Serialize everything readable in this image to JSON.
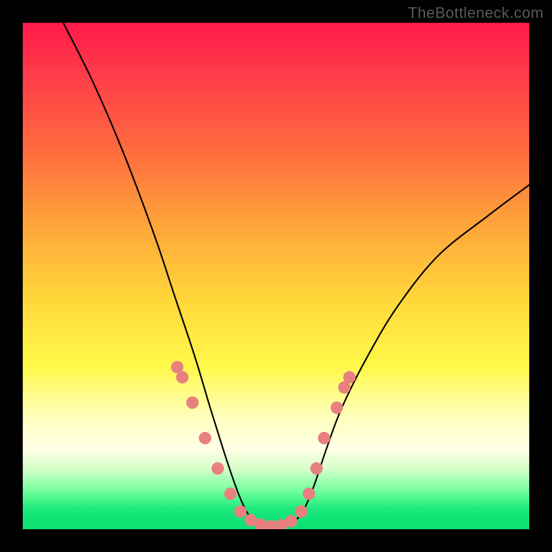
{
  "watermark": "TheBottleneck.com",
  "chart_data": {
    "type": "line",
    "title": "",
    "xlabel": "",
    "ylabel": "",
    "xlim": [
      0,
      100
    ],
    "ylim": [
      0,
      100
    ],
    "grid": false,
    "legend": null,
    "note": "Axes are unlabeled in the source image; values are normalized 0–100 estimated from pixel positions.",
    "series": [
      {
        "name": "curve",
        "color": "#000000",
        "x": [
          8,
          14,
          20,
          26,
          30,
          34,
          37,
          39.5,
          41.5,
          43,
          44.5,
          46,
          48,
          50,
          52,
          53.5,
          55,
          56.5,
          58,
          60,
          63,
          68,
          74,
          82,
          92,
          100
        ],
        "y": [
          100,
          88,
          74,
          58,
          46,
          34,
          24,
          16,
          10,
          6,
          3,
          1.5,
          0.7,
          0.5,
          0.7,
          1.5,
          3,
          6,
          10,
          16,
          24,
          34,
          44,
          54,
          62,
          68
        ]
      }
    ],
    "markers": {
      "name": "highlighted-points",
      "color": "#e98080",
      "radius_px": 9,
      "x": [
        30.5,
        31.5,
        33.5,
        36,
        38.5,
        41,
        43,
        45,
        47,
        49,
        51,
        53,
        55,
        56.5,
        58,
        59.5,
        62,
        63.5,
        64.5
      ],
      "y": [
        32,
        30,
        25,
        18,
        12,
        7,
        3.5,
        1.8,
        0.9,
        0.6,
        0.8,
        1.6,
        3.5,
        7,
        12,
        18,
        24,
        28,
        30
      ]
    },
    "gradient_stops": [
      {
        "pos": 0.0,
        "color": "#ff1a4a"
      },
      {
        "pos": 0.25,
        "color": "#ff6a3e"
      },
      {
        "pos": 0.55,
        "color": "#ffd83a"
      },
      {
        "pos": 0.78,
        "color": "#ffffbf"
      },
      {
        "pos": 0.92,
        "color": "#7dffa4"
      },
      {
        "pos": 1.0,
        "color": "#0de071"
      }
    ]
  }
}
